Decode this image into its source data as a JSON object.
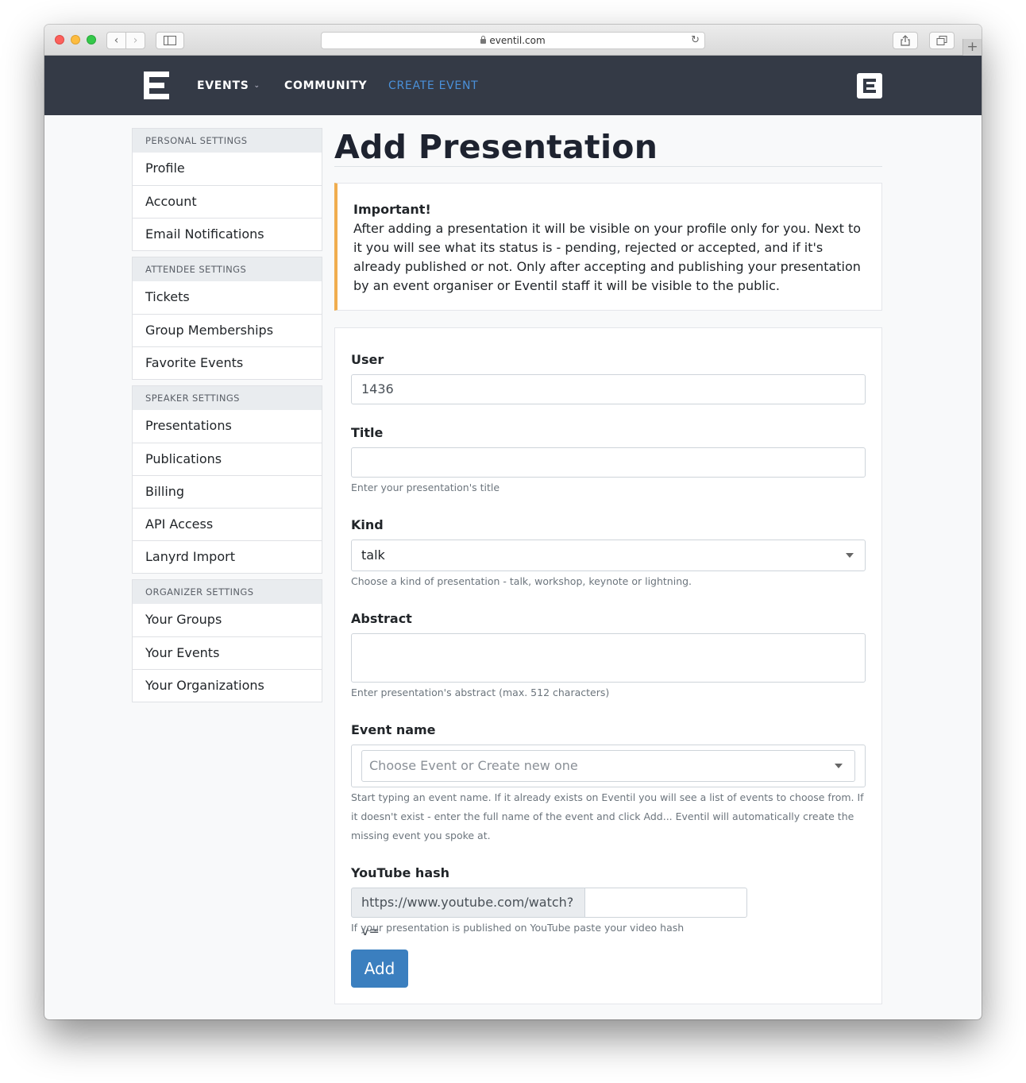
{
  "browser": {
    "url": "eventil.com",
    "reload_glyph": "↻",
    "new_tab_glyph": "+",
    "back_glyph": "‹",
    "forward_glyph": "›"
  },
  "navbar": {
    "events": "EVENTS",
    "events_caret": "⌄",
    "community": "COMMUNITY",
    "create_event": "CREATE EVENT"
  },
  "sidebar": {
    "groups": [
      {
        "header": "PERSONAL SETTINGS",
        "items": [
          "Profile",
          "Account",
          "Email Notifications"
        ]
      },
      {
        "header": "ATTENDEE SETTINGS",
        "items": [
          "Tickets",
          "Group Memberships",
          "Favorite Events"
        ]
      },
      {
        "header": "SPEAKER SETTINGS",
        "items": [
          "Presentations",
          "Publications",
          "Billing",
          "API Access",
          "Lanyrd Import"
        ]
      },
      {
        "header": "ORGANIZER SETTINGS",
        "items": [
          "Your Groups",
          "Your Events",
          "Your Organizations"
        ]
      }
    ]
  },
  "main": {
    "title": "Add Presentation",
    "alert": {
      "heading": "Important!",
      "body": "After adding a presentation it will be visible on your profile only for you. Next to it you will see what its status is - pending, rejected or accepted, and if it's already published or not. Only after accepting and publishing your presentation by an event organiser or Eventil staff it will be visible to the public."
    },
    "form": {
      "user_label": "User",
      "user_value": "1436",
      "title_label": "Title",
      "title_value": "",
      "title_help": "Enter your presentation's title",
      "kind_label": "Kind",
      "kind_value": "talk",
      "kind_help": "Choose a kind of presentation - talk, workshop, keynote or lightning.",
      "abstract_label": "Abstract",
      "abstract_value": "",
      "abstract_help": "Enter presentation's abstract (max. 512 characters)",
      "event_label": "Event name",
      "event_placeholder": "Choose Event or Create new one",
      "event_help": "Start typing an event name. If it already exists on Eventil you will see a list of events to choose from. If it doesn't exist - enter the full name of the event and click Add... Eventil will automatically create the missing event you spoke at.",
      "youtube_label": "YouTube hash",
      "youtube_prefix": "https://www.youtube.com/watch?v=",
      "youtube_value": "",
      "youtube_help": "If your presentation is published on YouTube paste your video hash",
      "submit_label": "Add"
    }
  },
  "colors": {
    "navbar_bg": "#343a46",
    "accent_link": "#4a90d9",
    "alert_border": "#f0ad4e",
    "primary_button": "#3b7fbf"
  }
}
